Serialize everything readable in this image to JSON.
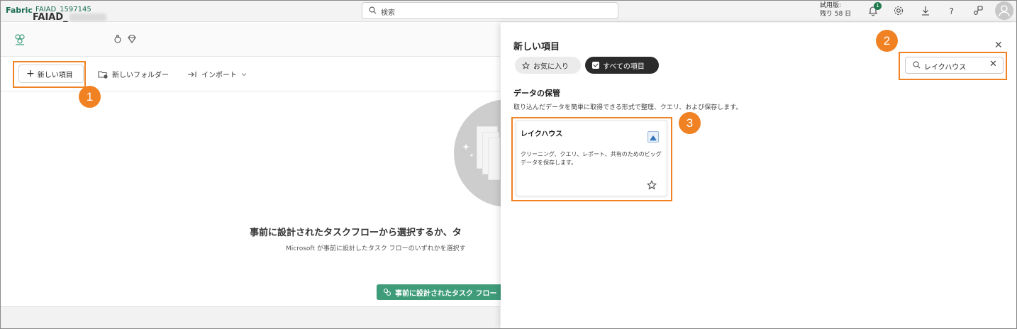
{
  "topbar": {
    "brand": "Fabric",
    "workspace": "FAIAD_1597145",
    "search_placeholder": "検索",
    "trial_line1": "試用版:",
    "trial_line2": "残り 58 日",
    "notification_count": "1"
  },
  "workspace": {
    "title": "FAIAD_",
    "toolbar": {
      "new_item": "新しい項目",
      "new_folder": "新しいフォルダー",
      "import": "インポート"
    },
    "empty_state": {
      "title": "事前に設計されたタスクフローから選択するか、タ",
      "subtitle": "Microsoft が事前に設計したタスク フローのいずれかを選択す",
      "button": "事前に設計されたタスク フロー"
    }
  },
  "panel": {
    "title": "新しい項目",
    "filters": {
      "favorites": "お気に入り",
      "all_items": "すべての項目"
    },
    "search_value": "レイクハウス",
    "section": {
      "title": "データの保管",
      "description": "取り込んだデータを簡単に取得できる形式で整理、クエリ、および保存します。"
    },
    "card": {
      "title": "レイクハウス",
      "description": "クリーニング、クエリ、レポート、共有のためのビッグ データを保存します。"
    }
  },
  "annotations": [
    "1",
    "2",
    "3"
  ],
  "colors": {
    "accent": "#f08224",
    "brand": "#1b6e55",
    "cta": "#3f9c7a"
  }
}
